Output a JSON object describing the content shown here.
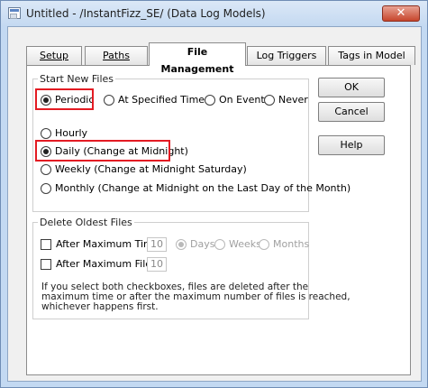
{
  "window": {
    "title": "Untitled - /InstantFizz_SE/ (Data Log Models)",
    "close_glyph": "✕"
  },
  "tabs": [
    {
      "label": "Setup",
      "active": false
    },
    {
      "label": "Paths",
      "active": false
    },
    {
      "label": "File Management",
      "active": true
    },
    {
      "label": "Log Triggers",
      "active": false
    },
    {
      "label": "Tags in Model",
      "active": false
    }
  ],
  "start_new_files": {
    "group_label": "Start New Files",
    "mode_options": [
      {
        "label": "Periodic",
        "selected": true
      },
      {
        "label": "At Specified Times",
        "selected": false
      },
      {
        "label": "On Event",
        "selected": false
      },
      {
        "label": "Never",
        "selected": false
      }
    ],
    "period_options": [
      {
        "label": "Hourly",
        "selected": false
      },
      {
        "label": "Daily (Change at Midnight)",
        "selected": true
      },
      {
        "label": "Weekly (Change at Midnight Saturday)",
        "selected": false
      },
      {
        "label": "Monthly (Change at Midnight on the Last Day of the Month)",
        "selected": false
      }
    ]
  },
  "delete_oldest_files": {
    "group_label": "Delete Oldest Files",
    "after_max_time": {
      "label": "After Maximum Time",
      "checked": false,
      "value": "10"
    },
    "unit_options": [
      {
        "label": "Days",
        "selected": true
      },
      {
        "label": "Weeks",
        "selected": false
      },
      {
        "label": "Months",
        "selected": false
      }
    ],
    "after_max_files": {
      "label": "After Maximum Files",
      "checked": false,
      "value": "10"
    },
    "note_lines": [
      "If you select both checkboxes, files are deleted after the",
      "maximum time or after the maximum number of files is reached,",
      "whichever happens first."
    ]
  },
  "buttons": {
    "ok": "OK",
    "cancel": "Cancel",
    "help": "Help"
  },
  "colors": {
    "highlight": "#e31b23",
    "close_button": "#c7452c"
  }
}
